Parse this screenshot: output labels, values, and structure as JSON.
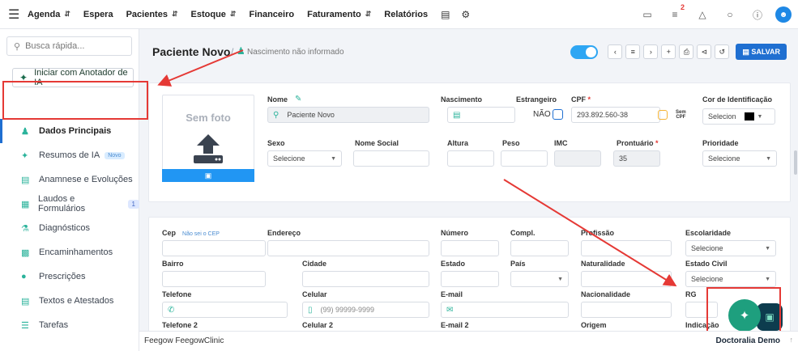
{
  "topbar": {
    "nav": [
      "Agenda",
      "Espera",
      "Pacientes",
      "Estoque",
      "Financeiro",
      "Faturamento",
      "Relatórios"
    ],
    "notification_count": "2",
    "avatar_letter": "⎂"
  },
  "sidebar": {
    "search_placeholder": "Busca rápida...",
    "ia_button": "Iniciar com Anotador de IA",
    "items": [
      {
        "label": "Dados Principais"
      },
      {
        "label": "Resumos de IA",
        "tag": "Novo"
      },
      {
        "label": "Anamnese e Evoluções"
      },
      {
        "label": "Laudos e Formulários",
        "count": "1"
      },
      {
        "label": "Diagnósticos"
      },
      {
        "label": "Encaminhamentos"
      },
      {
        "label": "Prescrições"
      },
      {
        "label": "Textos e Atestados"
      },
      {
        "label": "Tarefas"
      }
    ]
  },
  "header": {
    "title": "Paciente Novo",
    "separator": "/",
    "subtitle": "Nascimento não informado",
    "save": "SALVAR"
  },
  "card1": {
    "photo_label": "Sem foto",
    "fields": {
      "nome": "Nome",
      "nome_value": "Paciente Novo",
      "nascimento": "Nascimento",
      "estrangeiro": "Estrangeiro",
      "estrangeiro_value": "NÃO",
      "cpf": "CPF",
      "cpf_req": "*",
      "cpf_value": "293.892.560-38",
      "sem_cpf_1": "Sem",
      "sem_cpf_2": "CPF",
      "cor": "Cor de Identificação",
      "cor_value": "Selecion",
      "sexo": "Sexo",
      "sexo_value": "Selecione",
      "nome_social": "Nome Social",
      "altura": "Altura",
      "peso": "Peso",
      "imc": "IMC",
      "prontuario": "Prontuário",
      "prontuario_req": "*",
      "prontuario_value": "35",
      "prioridade": "Prioridade",
      "prioridade_value": "Selecione"
    }
  },
  "card2": {
    "cep": "Cep",
    "cep_link": "Não sei o CEP",
    "endereco": "Endereço",
    "numero": "Número",
    "compl": "Compl.",
    "profissao": "Profissão",
    "escolaridade": "Escolaridade",
    "escolaridade_value": "Selecione",
    "bairro": "Bairro",
    "cidade": "Cidade",
    "estado": "Estado",
    "pais": "País",
    "naturalidade": "Naturalidade",
    "estado_civil": "Estado Civil",
    "estado_civil_value": "Selecione",
    "telefone": "Telefone",
    "celular": "Celular",
    "celular_placeholder": "(99) 99999-9999",
    "email": "E-mail",
    "nacionalidade": "Nacionalidade",
    "rg": "RG",
    "telefone2": "Telefone 2",
    "celular2": "Celular 2",
    "email2": "E-mail 2",
    "origem": "Origem",
    "indicacao": "Indicação"
  },
  "footer": {
    "left": "Feegow FeegowClinic",
    "right": "Doctoralia Demo"
  },
  "colors": {
    "primary": "#1f6fd1",
    "accent": "#2bb39b",
    "highlight": "#e53935",
    "fab": "#1e9f7e"
  }
}
